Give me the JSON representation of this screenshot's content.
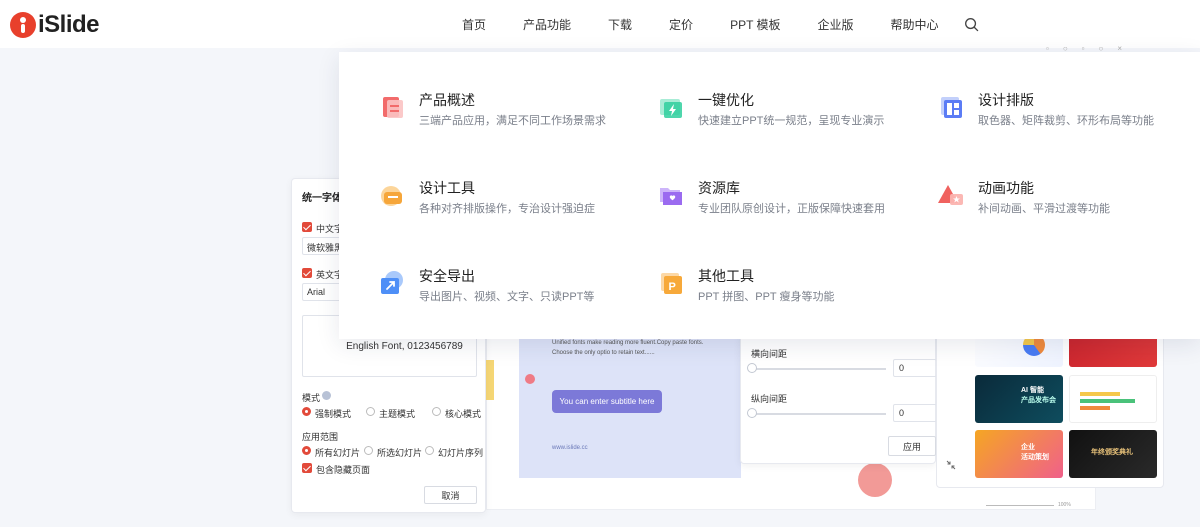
{
  "header": {
    "logo_text": "iSlide",
    "nav": [
      "首页",
      "产品功能",
      "下载",
      "定价",
      "PPT 模板",
      "企业版",
      "帮助中心"
    ]
  },
  "menu": {
    "items": [
      {
        "title": "产品概述",
        "desc": "三端产品应用，满足不同工作场景需求",
        "icon": "document-icon",
        "color": "#f26b6b"
      },
      {
        "title": "一键优化",
        "desc": "快速建立PPT统一规范，呈现专业演示",
        "icon": "lightning-icon",
        "color": "#2fcf9e"
      },
      {
        "title": "设计排版",
        "desc": "取色器、矩阵裁剪、环形布局等功能",
        "icon": "layout-icon",
        "color": "#5b7cf5"
      },
      {
        "title": "设计工具",
        "desc": "各种对齐排版操作，专治设计强迫症",
        "icon": "toolbox-icon",
        "color": "#f6a63a"
      },
      {
        "title": "资源库",
        "desc": "专业团队原创设计，正版保障快速套用",
        "icon": "folder-icon",
        "color": "#9b6bf0"
      },
      {
        "title": "动画功能",
        "desc": "补间动画、平滑过渡等功能",
        "icon": "animation-icon",
        "color": "#f0625f"
      },
      {
        "title": "安全导出",
        "desc": "导出图片、视频、文字、只读PPT等",
        "icon": "export-icon",
        "color": "#4e8ff7"
      },
      {
        "title": "其他工具",
        "desc": "PPT 拼图、PPT 瘦身等功能",
        "icon": "other-tools-icon",
        "color": "#f7a93a"
      }
    ]
  },
  "panel": {
    "title": "统一字体",
    "cn_label": "中文字体",
    "cn_font": "微软雅黑",
    "en_label": "英文字体",
    "en_font": "Arial",
    "preview": "English Font, 0123456789",
    "mode_label": "模式",
    "modes": [
      "强制模式",
      "主题模式",
      "核心模式"
    ],
    "scope_label": "应用范围",
    "scopes": [
      "所有幻灯片",
      "所选幻灯片",
      "幻灯片序列"
    ],
    "hidden_label": "包含隐藏页面",
    "cancel": "取消"
  },
  "slide": {
    "line1": "Unified fonts make reading more fluent.Copy paste fonts.",
    "line2": "Choose the only optio to retain text......",
    "button": "You can enter subtitle here",
    "url": "www.islide.cc"
  },
  "spacing": {
    "horizontal_label": "横向间距",
    "horizontal_value": "0",
    "vertical_label": "纵向间距",
    "vertical_value": "0",
    "apply": "应用"
  },
  "thumbs": {
    "ai_title": "AI 智能",
    "ai_sub": "产品发布会",
    "event_title": "企业",
    "event_sub": "活动策划",
    "award_title": "年终颁奖典礼"
  },
  "zoom": "100%"
}
